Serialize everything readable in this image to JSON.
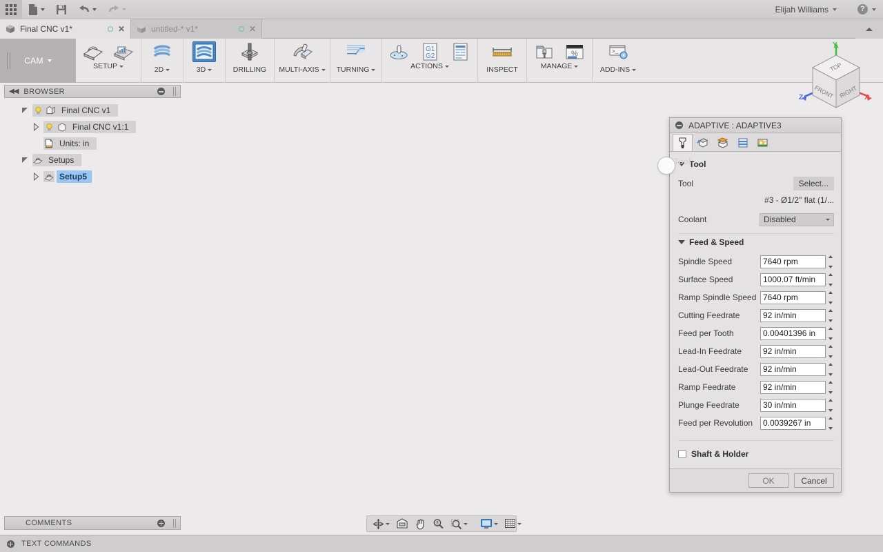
{
  "topbar": {
    "apps_icon": "grid-apps-icon",
    "new_icon": "new-document-icon",
    "save_icon": "save-icon",
    "undo_icon": "undo-icon",
    "redo_icon": "redo-icon",
    "user_name": "Elijah Williams",
    "help_icon": "help-icon"
  },
  "tabs": [
    {
      "label": "Final CNC v1*",
      "active": true
    },
    {
      "label": "untitled-* v1*",
      "active": false
    }
  ],
  "ribbon": {
    "workspace": "CAM",
    "groups": [
      {
        "label": "SETUP",
        "has_caret": true,
        "items": [
          "setup-icon",
          "setup-sheet-icon"
        ]
      },
      {
        "label": "2D",
        "has_caret": true,
        "items": [
          "2d-toolpath-icon"
        ]
      },
      {
        "label": "3D",
        "has_caret": true,
        "items": [
          "3d-toolpath-icon"
        ],
        "active": true
      },
      {
        "label": "DRILLING",
        "has_caret": false,
        "items": [
          "drilling-icon"
        ]
      },
      {
        "label": "MULTI-AXIS",
        "has_caret": true,
        "items": [
          "multi-axis-icon"
        ]
      },
      {
        "label": "TURNING",
        "has_caret": true,
        "items": [
          "turning-icon"
        ]
      },
      {
        "label": "ACTIONS",
        "has_caret": true,
        "items": [
          "simulate-icon",
          "post-process-g1g2-icon",
          "setup-sheet-doc-icon"
        ]
      },
      {
        "label": "INSPECT",
        "has_caret": false,
        "items": [
          "measure-ruler-icon"
        ]
      },
      {
        "label": "MANAGE",
        "has_caret": true,
        "items": [
          "tool-library-icon",
          "machining-time-percent-icon"
        ]
      },
      {
        "label": "ADD-INS",
        "has_caret": true,
        "items": [
          "scripts-addins-icon"
        ]
      }
    ]
  },
  "browser": {
    "title": "BROWSER",
    "collapse_icon": "collapse-left-icon",
    "minimize_icon": "minimize-icon",
    "tree": [
      {
        "label": "Final CNC v1",
        "indent": 0,
        "arrow": "down",
        "bulb": true,
        "icon": "document-icon",
        "selected": false
      },
      {
        "label": "Final CNC v1:1",
        "indent": 1,
        "arrow": "right",
        "bulb": true,
        "icon": "body-icon",
        "selected": false
      },
      {
        "label": "Units: in",
        "indent": 1,
        "arrow": "none",
        "bulb": false,
        "icon": "units-icon",
        "selected": false
      },
      {
        "label": "Setups",
        "indent": 0,
        "arrow": "down",
        "bulb": false,
        "icon": "setups-icon",
        "selected": false
      },
      {
        "label": "Setup5",
        "indent": 1,
        "arrow": "right",
        "bulb": false,
        "icon": "setup-item-icon",
        "selected": true
      }
    ]
  },
  "viewcube": {
    "top_face": "TOP",
    "front_face": "FRONT",
    "right_face": "RIGHT",
    "axis_x": "X",
    "axis_y": "Y",
    "axis_z": "Z",
    "color_x": "#e8494e",
    "color_y": "#3fc23f",
    "color_z": "#4a6ae0"
  },
  "dialog": {
    "title": "ADAPTIVE : ADAPTIVE3",
    "tabs": [
      {
        "name": "tool-tab",
        "active": true
      },
      {
        "name": "geometry-tab",
        "active": false
      },
      {
        "name": "heights-tab",
        "active": false
      },
      {
        "name": "passes-tab",
        "active": false
      },
      {
        "name": "linking-tab",
        "active": false
      }
    ],
    "ghost_watermark": "Tool",
    "sections": [
      {
        "title": "Tool",
        "rows": [
          {
            "type": "button",
            "label": "Tool",
            "value": "Select...",
            "name": "tool-select-button"
          },
          {
            "type": "text",
            "label": "",
            "value": "#3 - Ø1/2\" flat (1/...",
            "name": "tool-description"
          },
          {
            "type": "select",
            "label": "Coolant",
            "value": "Disabled",
            "name": "coolant-select"
          }
        ]
      },
      {
        "title": "Feed & Speed",
        "rows": [
          {
            "type": "spin",
            "label": "Spindle Speed",
            "value": "7640 rpm",
            "name": "spindle-speed-input"
          },
          {
            "type": "spin",
            "label": "Surface Speed",
            "value": "1000.07 ft/min",
            "name": "surface-speed-input"
          },
          {
            "type": "spin",
            "label": "Ramp Spindle Speed",
            "value": "7640 rpm",
            "name": "ramp-spindle-speed-input"
          },
          {
            "type": "spin",
            "label": "Cutting Feedrate",
            "value": "92 in/min",
            "name": "cutting-feedrate-input"
          },
          {
            "type": "spin",
            "label": "Feed per Tooth",
            "value": "0.00401396 in",
            "name": "feed-per-tooth-input"
          },
          {
            "type": "spin",
            "label": "Lead-In Feedrate",
            "value": "92 in/min",
            "name": "lead-in-feedrate-input"
          },
          {
            "type": "spin",
            "label": "Lead-Out Feedrate",
            "value": "92 in/min",
            "name": "lead-out-feedrate-input"
          },
          {
            "type": "spin",
            "label": "Ramp Feedrate",
            "value": "92 in/min",
            "name": "ramp-feedrate-input"
          },
          {
            "type": "spin",
            "label": "Plunge Feedrate",
            "value": "30 in/min",
            "name": "plunge-feedrate-input"
          },
          {
            "type": "spin",
            "label": "Feed per Revolution",
            "value": "0.0039267 in",
            "name": "feed-per-revolution-input"
          }
        ]
      }
    ],
    "checkbox": {
      "label": "Shaft & Holder",
      "checked": false
    },
    "ok_label": "OK",
    "cancel_label": "Cancel"
  },
  "navbar": {
    "items": [
      {
        "name": "orbit-icon",
        "caret": true
      },
      {
        "name": "look-at-icon",
        "caret": false
      },
      {
        "name": "pan-hand-icon",
        "caret": false
      },
      {
        "name": "zoom-icon",
        "caret": false
      },
      {
        "name": "fit-icon",
        "caret": true
      },
      {
        "name": "display-settings-icon",
        "caret": true
      },
      {
        "name": "grid-snaps-icon",
        "caret": true
      }
    ]
  },
  "bottom": {
    "comments_label": "COMMENTS",
    "text_commands_label": "TEXT COMMANDS"
  },
  "colors": {
    "accent_blue": "#4a87c4",
    "selection_blue": "#9ac7f0",
    "stock_side": "#7b7872",
    "stock_top": "#b3a894",
    "tool_holder": "#22313f",
    "background": "#eceaea"
  }
}
